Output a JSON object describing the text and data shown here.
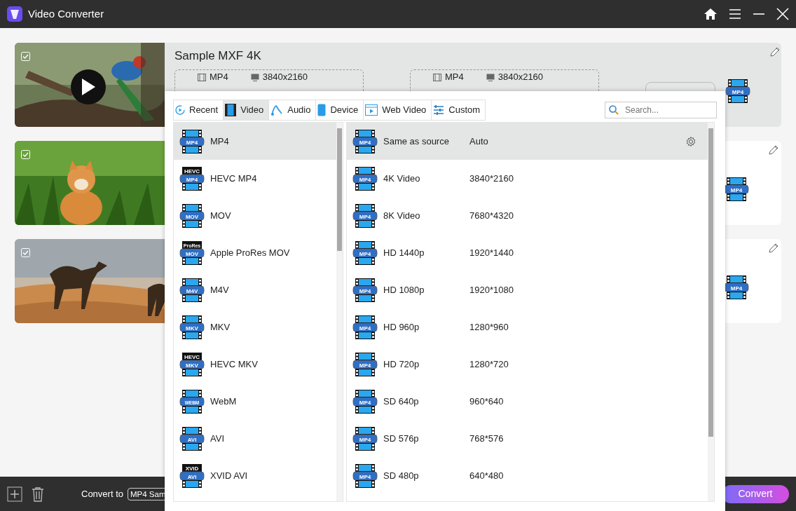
{
  "window": {
    "title": "Video Converter"
  },
  "files": [
    {
      "title": "Sample MXF 4K",
      "selected": true,
      "checked": true,
      "play_button": true,
      "outputs": [
        {
          "format": "MP4",
          "resolution": "3840x2160"
        },
        {
          "format": "MP4",
          "resolution": "3840x2160"
        }
      ],
      "format_icon": "MP4"
    },
    {
      "selected": false,
      "checked": true,
      "play_button": false,
      "format_icon": "MP4"
    },
    {
      "selected": false,
      "checked": true,
      "play_button": false,
      "format_icon": "MP4"
    }
  ],
  "format_panel": {
    "tabs": [
      {
        "kind": "recent",
        "label": "Recent",
        "selected": false
      },
      {
        "kind": "video",
        "label": "Video",
        "selected": true
      },
      {
        "kind": "audio",
        "label": "Audio",
        "selected": false
      },
      {
        "kind": "device",
        "label": "Device",
        "selected": false
      },
      {
        "kind": "web",
        "label": "Web Video",
        "selected": false
      },
      {
        "kind": "custom",
        "label": "Custom",
        "selected": false
      }
    ],
    "search": {
      "placeholder": "Search..."
    },
    "formats": [
      {
        "name": "MP4",
        "badge": "MP4",
        "selected": true
      },
      {
        "name": "HEVC MP4",
        "badge": "MP4",
        "top_label": "HEVC",
        "selected": false
      },
      {
        "name": "MOV",
        "badge": "MOV",
        "selected": false
      },
      {
        "name": "Apple ProRes MOV",
        "badge": "MOV",
        "top_label": "ProRes",
        "selected": false
      },
      {
        "name": "M4V",
        "badge": "M4V",
        "selected": false
      },
      {
        "name": "MKV",
        "badge": "MKV",
        "selected": false
      },
      {
        "name": "HEVC MKV",
        "badge": "MKV",
        "top_label": "HEVC",
        "selected": false
      },
      {
        "name": "WebM",
        "badge": "WEBM",
        "selected": false
      },
      {
        "name": "AVI",
        "badge": "AVI",
        "selected": false
      },
      {
        "name": "XVID AVI",
        "badge": "AVI",
        "top_label": "XVID",
        "selected": false
      }
    ],
    "presets": [
      {
        "name": "Same as source",
        "resolution": "Auto",
        "badge": "MP4",
        "selected": true
      },
      {
        "name": "4K Video",
        "resolution": "3840*2160",
        "badge": "MP4",
        "selected": false
      },
      {
        "name": "8K Video",
        "resolution": "7680*4320",
        "badge": "MP4",
        "selected": false
      },
      {
        "name": "HD 1440p",
        "resolution": "1920*1440",
        "badge": "MP4",
        "selected": false
      },
      {
        "name": "HD 1080p",
        "resolution": "1920*1080",
        "badge": "MP4",
        "selected": false
      },
      {
        "name": "HD 960p",
        "resolution": "1280*960",
        "badge": "MP4",
        "selected": false
      },
      {
        "name": "HD 720p",
        "resolution": "1280*720",
        "badge": "MP4",
        "selected": false
      },
      {
        "name": "SD 640p",
        "resolution": "960*640",
        "badge": "MP4",
        "selected": false
      },
      {
        "name": "SD 576p",
        "resolution": "768*576",
        "badge": "MP4",
        "selected": false
      },
      {
        "name": "SD 480p",
        "resolution": "640*480",
        "badge": "MP4",
        "selected": false
      }
    ]
  },
  "bottom_bar": {
    "convert_label": "Convert to",
    "target": "MP4 Sam",
    "convert_button": "Convert"
  }
}
